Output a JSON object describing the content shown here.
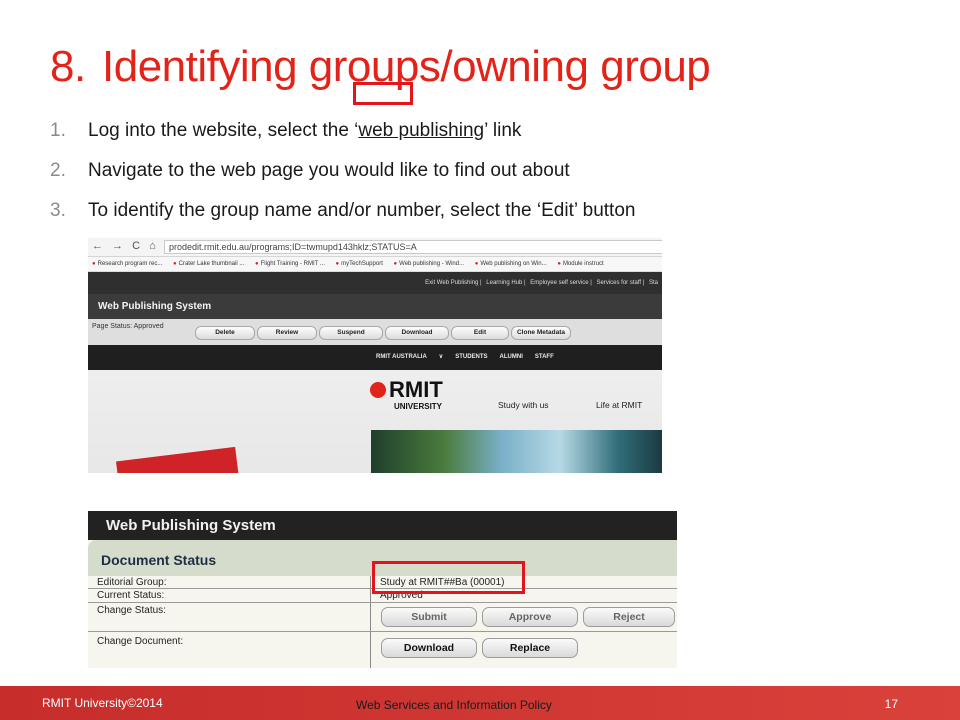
{
  "slide": {
    "title_number": "8.",
    "title_text": "Identifying groups/owning group",
    "steps": [
      {
        "num": "1.",
        "before": "Log into the website, select the ‘",
        "link": "web publishing",
        "after": "’ link"
      },
      {
        "num": "2.",
        "text": "Navigate to the web page you would like to find out about"
      },
      {
        "num": "3.",
        "text": "To identify the group name and/or number, select the ‘Edit’ button"
      }
    ]
  },
  "screenshot1": {
    "nav_icons": "← → C ⌂",
    "url": "prodedit.rmit.edu.au/programs;ID=twmupd143hklz;STATUS=A",
    "bookmarks": [
      "Research program rec...",
      "Crater Lake thumbnail ...",
      "Flight Training - RMIT ...",
      "myTechSupport",
      "Web publishing - Wind...",
      "Web publishing on Win...",
      "Module instruct"
    ],
    "top_links": [
      "Exit Web Publishing",
      "Learning Hub",
      "Employee self service",
      "Services for staff",
      "Sta"
    ],
    "system_title": "Web Publishing System",
    "page_status": "Page Status: Approved",
    "buttons": [
      "Delete",
      "Review",
      "Suspend",
      "Download",
      "Edit",
      "Clone Metadata"
    ],
    "rmit_nav": [
      "RMIT AUSTRALIA",
      "∨",
      "STUDENTS",
      "ALUMNI",
      "STAFF"
    ],
    "logo_name": "RMIT",
    "logo_sub": "UNIVERSITY",
    "banner_links": [
      "Study with us",
      "Life at RMIT"
    ]
  },
  "screenshot2": {
    "system_title": "Web Publishing System",
    "section_title": "Document Status",
    "editorial_group_label": "Editorial Group:",
    "editorial_group_value": "Study at RMIT##Ba (00001)",
    "current_status_label": "Current Status:",
    "current_status_value": "Approved",
    "change_status_label": "Change Status:",
    "change_status_buttons": [
      "Submit",
      "Approve",
      "Reject"
    ],
    "change_document_label": "Change Document:",
    "change_document_buttons": [
      "Download",
      "Replace"
    ]
  },
  "footer": {
    "left": "RMIT University©2014",
    "center": "Web Services and Information Policy",
    "page": "17"
  },
  "colors": {
    "accent_red": "#e2231a",
    "highlight_box": "#e3141b",
    "footer_red": "#c62d2b"
  }
}
